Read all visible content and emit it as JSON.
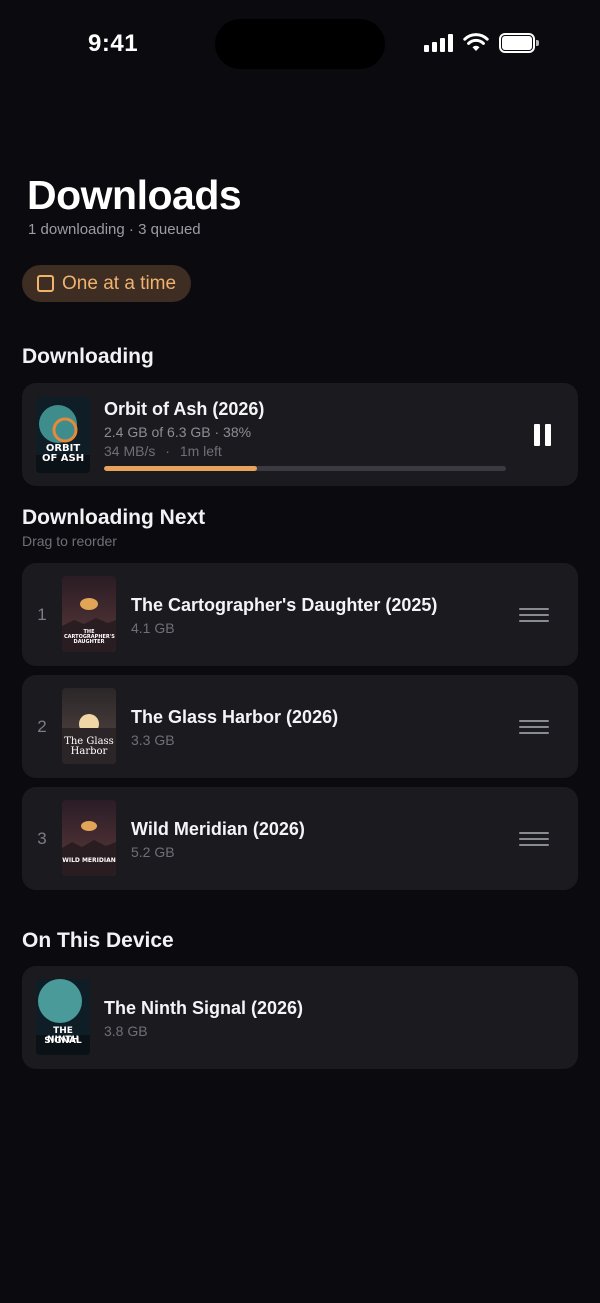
{
  "status_bar": {
    "time": "9:41"
  },
  "header": {
    "title": "Downloads",
    "subtitle": "1 downloading · 3 queued"
  },
  "toggle": {
    "label": "One at a time",
    "checked": false,
    "accent": "#f1b26e"
  },
  "downloading": {
    "section_title": "Downloading",
    "item": {
      "title": "Orbit of Ash (2026)",
      "progress_text": "2.4 GB of 6.3 GB · 38%",
      "speed": "34 MB/s",
      "separator": "·",
      "time_left": "1m left",
      "progress": 0.38,
      "poster_text_line1": "ORBIT",
      "poster_text_line2": "OF ASH"
    }
  },
  "queue": {
    "section_title": "Downloading Next",
    "hint": "Drag to reorder",
    "items": [
      {
        "number": "1",
        "title": "The Cartographer's Daughter (2025)",
        "size": "4.1 GB",
        "poster_text": "THE CARTOGRAPHER'S DAUGHTER"
      },
      {
        "number": "2",
        "title": "The Glass Harbor (2026)",
        "size": "3.3 GB",
        "poster_text_line1": "The Glass",
        "poster_text_line2": "Harbor"
      },
      {
        "number": "3",
        "title": "Wild Meridian (2026)",
        "size": "5.2 GB",
        "poster_text": "WILD MERIDIAN"
      }
    ]
  },
  "device": {
    "section_title": "On This Device",
    "items": [
      {
        "title": "The Ninth Signal (2026)",
        "size": "3.8 GB",
        "poster_text_line1": "THE NINTH",
        "poster_text_line2": "SIGNAL"
      }
    ]
  },
  "colors": {
    "background": "#0b0b0f",
    "card": "#1a1a1f",
    "accent": "#e7a35c"
  }
}
